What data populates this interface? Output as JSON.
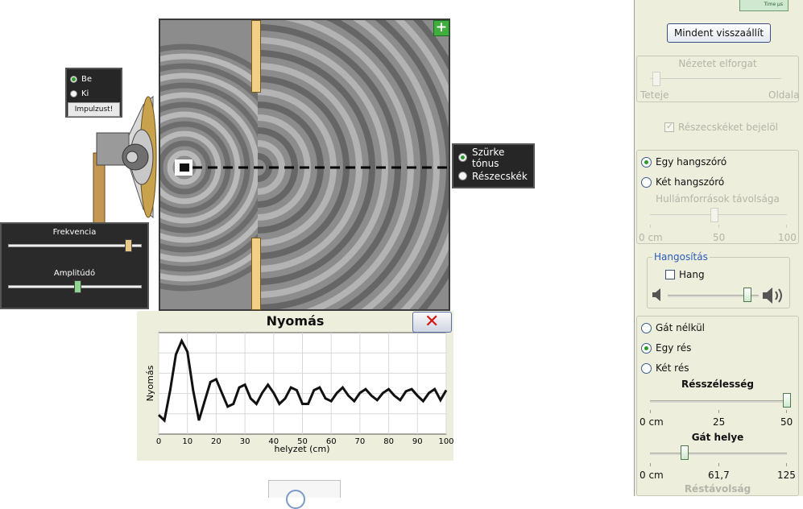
{
  "simulation": {
    "source_mode": {
      "options": [
        "Be",
        "Ki"
      ],
      "selected": "Be",
      "pulse_label": "Impulzust!"
    },
    "view_mode": {
      "options": [
        "Szürke tónus",
        "Részecskék"
      ],
      "selected": "Szürke tónus"
    },
    "wave_controls": {
      "frequency_label": "Frekvencia",
      "frequency_level": 0.9,
      "amplitude_label": "Amplitúdó",
      "amplitude_level": 0.52
    }
  },
  "chart_panel": {
    "title": "Nyomás",
    "close_icon": "close-x-icon",
    "close_color": "#d41515"
  },
  "chart_data": {
    "type": "line",
    "title": "Nyomás",
    "xlabel": "helyzet (cm)",
    "ylabel": "Nyomás",
    "xlim": [
      0,
      100
    ],
    "x_ticks": [
      "0",
      "10",
      "20",
      "30",
      "40",
      "50",
      "60",
      "70",
      "80",
      "90",
      "100"
    ],
    "grid": true,
    "series": [
      {
        "x": [
          0,
          2,
          4,
          6,
          8,
          10,
          12,
          14,
          16,
          18,
          20,
          22,
          24,
          26,
          28,
          30,
          32,
          34,
          36,
          38,
          40,
          42,
          44,
          46,
          48,
          50,
          52,
          54,
          56,
          58,
          60,
          62,
          64,
          66,
          68,
          70,
          72,
          74,
          76,
          78,
          80,
          82,
          84,
          86,
          88,
          90,
          92,
          94,
          96,
          98,
          100
        ],
        "y": [
          -0.35,
          -0.45,
          0.1,
          0.75,
          1.0,
          0.8,
          0.1,
          -0.45,
          -0.1,
          0.25,
          0.3,
          0.05,
          -0.2,
          -0.15,
          0.15,
          0.2,
          -0.05,
          -0.15,
          0.05,
          0.2,
          0.05,
          -0.15,
          -0.05,
          0.15,
          0.1,
          -0.15,
          -0.15,
          0.1,
          0.15,
          -0.05,
          -0.1,
          0.05,
          0.15,
          0.0,
          -0.1,
          0.05,
          0.12,
          0.0,
          -0.08,
          0.05,
          0.12,
          0.0,
          -0.08,
          0.08,
          0.12,
          0.0,
          -0.1,
          0.05,
          0.12,
          -0.08,
          0.1
        ]
      }
    ]
  },
  "right_panel": {
    "reset_label": "Mindent visszaállít",
    "rotate": {
      "title": "Nézetet elforgat",
      "min_label": "Teteje",
      "max_label": "Oldala",
      "level": 0.05
    },
    "mark_particles_label": "Részecskéket bejelöl",
    "speakers": {
      "options": [
        "Egy hangszóró",
        "Két hangszóró"
      ],
      "selected": "Egy hangszóró",
      "distance_title": "Hullámforrások távolsága",
      "tick_labels": [
        "0 cm",
        "50",
        "100"
      ],
      "level": 0.47
    },
    "sound": {
      "title": "Hangosítás",
      "checkbox_label": "Hang",
      "checked": false,
      "volume_level": 0.88
    },
    "barrier": {
      "options": [
        "Gát nélkül",
        "Egy rés",
        "Két rés"
      ],
      "selected": "Egy rés",
      "slit_width_title": "Résszélesség",
      "slit_width_ticks": [
        "0 cm",
        "25",
        "50"
      ],
      "slit_width_level": 1.0,
      "position_title": "Gát helye",
      "position_ticks": [
        "0 cm",
        "61,7",
        "125"
      ],
      "position_level": 0.25,
      "separation_title": "Réstávolság"
    }
  }
}
